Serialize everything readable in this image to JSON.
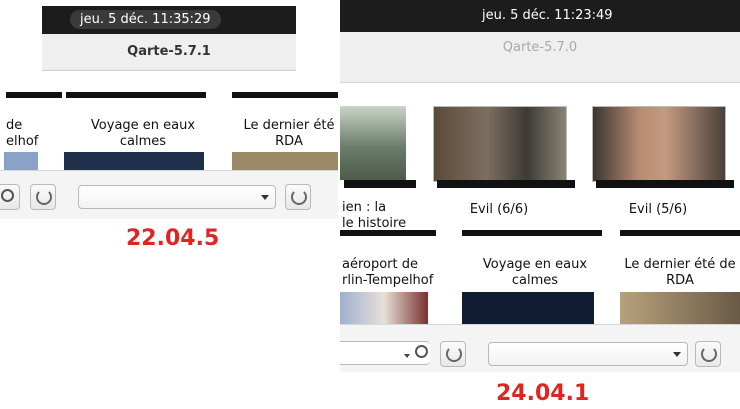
{
  "left": {
    "clock": "jeu. 5 déc.   11:35:29",
    "window_title": "Qarte-5.7.1",
    "tiles": [
      "de\nelhof",
      "Voyage en eaux\ncalmes",
      "Le dernier été\nRDA"
    ],
    "version_label": "22.04.5"
  },
  "right": {
    "clock": "jeu. 5 déc.   11:23:49",
    "window_title": "Qarte-5.7.0",
    "row1_tiles": [
      "ien : la\nle histoire",
      "Evil (6/6)",
      "Evil (5/6)"
    ],
    "row2_tiles": [
      "aéroport de\nrlin-Tempelhof",
      "Voyage en eaux\ncalmes",
      "Le dernier été de\nRDA"
    ],
    "version_label": "24.04.1"
  },
  "colors": {
    "version_red": "#e02424",
    "topbar": "#1c1c1c"
  }
}
